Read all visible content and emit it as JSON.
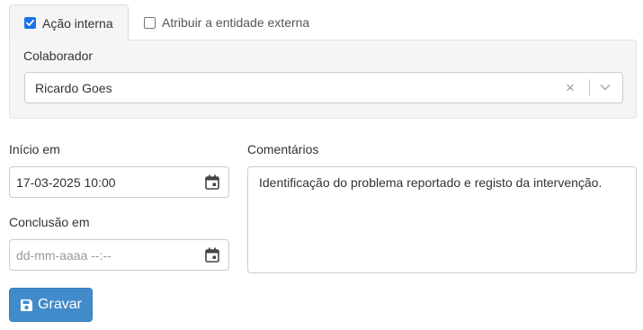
{
  "tabs": {
    "internal": {
      "label": "Ação interna",
      "checked": true
    },
    "external": {
      "label": "Atribuir a entidade externa",
      "checked": false
    }
  },
  "collaborator": {
    "label": "Colaborador",
    "value": "Ricardo Goes",
    "clear_glyph": "×",
    "icons": [
      "clear-icon",
      "chevron-down-icon"
    ]
  },
  "start": {
    "label": "Início em",
    "value": "17-03-2025 10:00",
    "icon": "calendar-icon"
  },
  "end": {
    "label": "Conclusão em",
    "placeholder": "dd-mm-aaaa --:--",
    "icon": "calendar-icon"
  },
  "comments": {
    "label": "Comentários",
    "value": "Identificação do problema reportado e registo da intervenção."
  },
  "save_button": {
    "label": "Gravar",
    "icon": "floppy-disk-icon"
  },
  "colors": {
    "primary_button": "#428bca",
    "checkbox_checked": "#1a73e8",
    "panel_bg": "#f5f5f5"
  }
}
